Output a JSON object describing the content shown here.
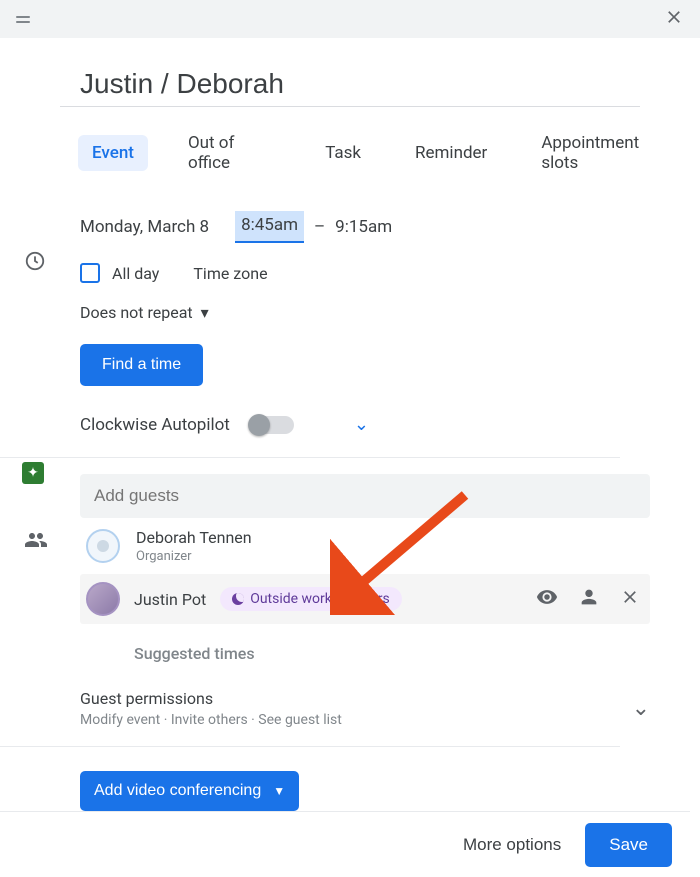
{
  "event_title": "Justin / Deborah",
  "tabs": [
    "Event",
    "Out of office",
    "Task",
    "Reminder",
    "Appointment slots"
  ],
  "time": {
    "date": "Monday, March 8",
    "start": "8:45am",
    "sep": "–",
    "end": "9:15am",
    "allday_label": "All day",
    "tz_label": "Time zone",
    "repeat_label": "Does not repeat",
    "findtime_label": "Find a time"
  },
  "autopilot": {
    "label": "Clockwise Autopilot"
  },
  "guests": {
    "placeholder": "Add guests",
    "items": [
      {
        "name": "Deborah Tennen",
        "sub": "Organizer"
      },
      {
        "name": "Justin Pot",
        "status": "Outside working hours"
      }
    ],
    "suggested_label": "Suggested times",
    "perm_title": "Guest permissions",
    "perm_sub": "Modify event  ·  Invite others  ·  See guest list"
  },
  "vc": {
    "label": "Add video conferencing"
  },
  "footer": {
    "more": "More options",
    "save": "Save"
  }
}
